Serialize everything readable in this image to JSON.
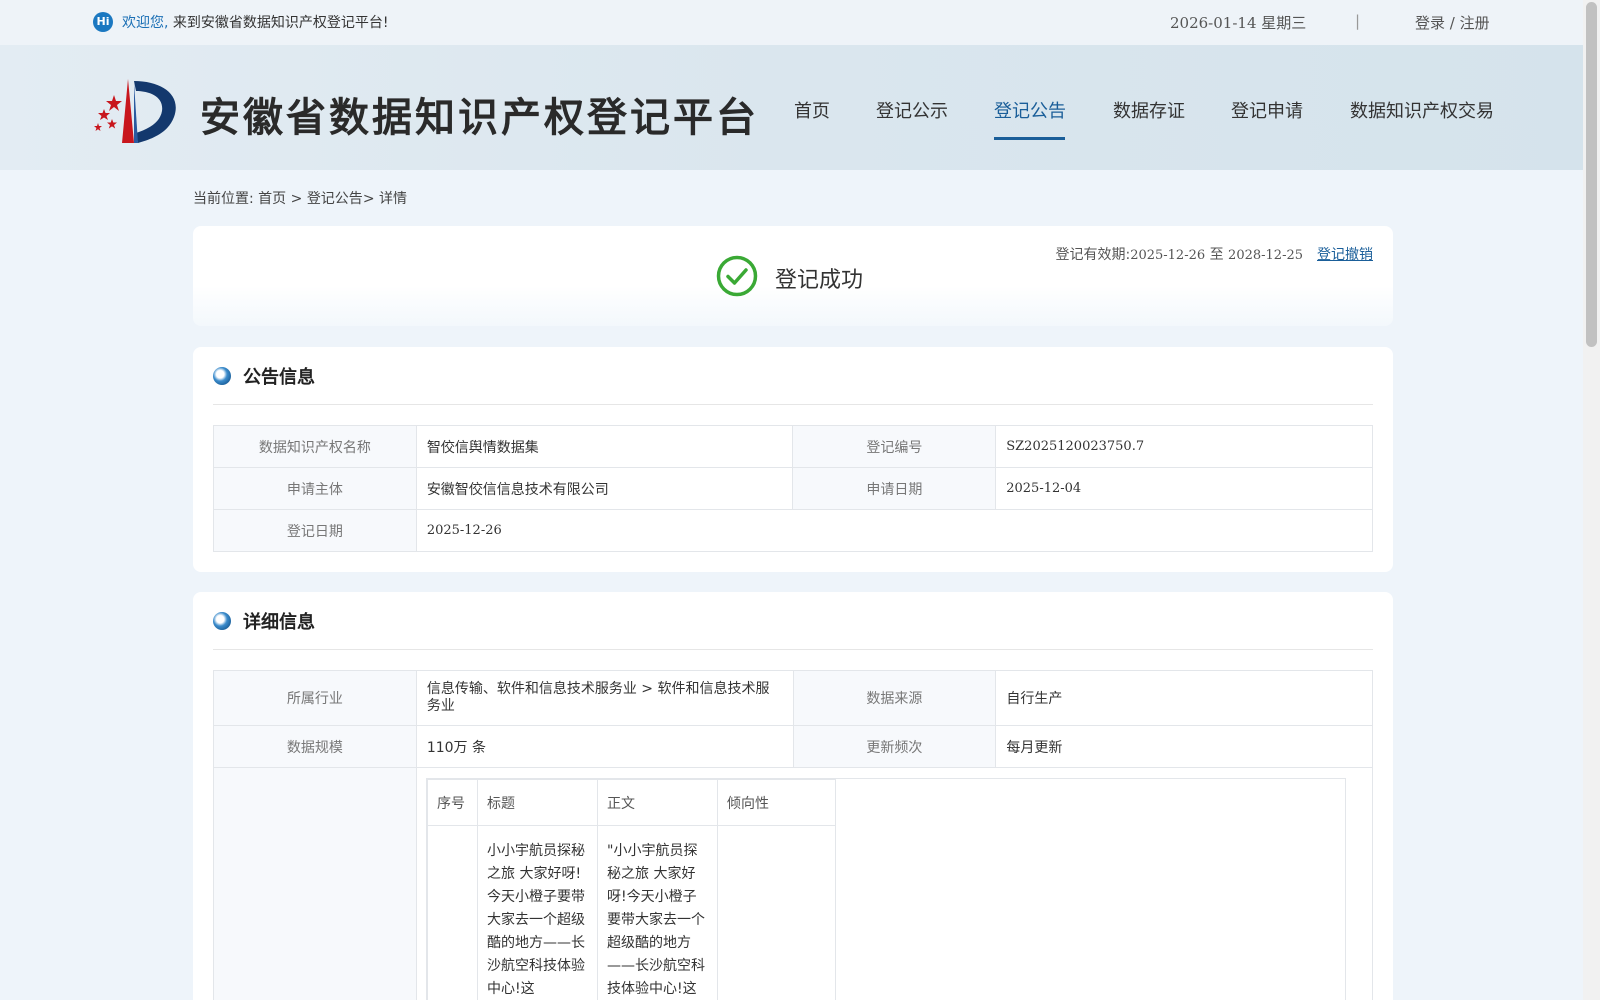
{
  "topbar": {
    "hi_badge": "Hi",
    "welcome_highlight": "欢迎您,",
    "welcome_text": "来到安徽省数据知识产权登记平台!",
    "date": "2026-01-14 星期三",
    "separator": "|",
    "login_register": "登录 / 注册"
  },
  "header": {
    "site_title": "安徽省数据知识产权登记平台",
    "nav": [
      {
        "label": "首页"
      },
      {
        "label": "登记公示"
      },
      {
        "label": "登记公告"
      },
      {
        "label": "数据存证"
      },
      {
        "label": "登记申请"
      },
      {
        "label": "数据知识产权交易"
      }
    ],
    "active_nav": "登记公告"
  },
  "breadcrumb": {
    "prefix": "当前位置:",
    "home": "首页",
    "sep1": ">",
    "section": "登记公告",
    "sep2": ">",
    "current": "详情"
  },
  "status": {
    "text": "登记成功",
    "validity_label": "登记有效期:",
    "validity_start": "2025-12-26",
    "validity_to": "至",
    "validity_end": "2028-12-25",
    "revoke_label": "登记撤销"
  },
  "notice_section": {
    "title": "公告信息",
    "rows": [
      {
        "l1": "数据知识产权名称",
        "v1": "智佼信舆情数据集",
        "l2": "登记编号",
        "v2": "SZ2025120023750.7"
      },
      {
        "l1": "申请主体",
        "v1": "安徽智佼信信息技术有限公司",
        "l2": "申请日期",
        "v2": "2025-12-04"
      },
      {
        "l1": "登记日期",
        "v1": "2025-12-26"
      }
    ]
  },
  "detail_section": {
    "title": "详细信息",
    "industry_label": "所属行业",
    "industry_value": "信息传输、软件和信息技术服务业 > 软件和信息技术服务业",
    "source_label": "数据来源",
    "source_value": "自行生产",
    "scale_label": "数据规模",
    "scale_value": "110万 条",
    "freq_label": "更新频次",
    "freq_value": "每月更新",
    "sample_table": {
      "headers": [
        "序号",
        "标题",
        "正文",
        "倾向性"
      ],
      "row": {
        "index": "",
        "title": "小小宇航员探秘之旅 大家好呀!今天小橙子要带大家去一个超级酷的地方——长沙航空科技体验中心!这",
        "body": "\"小小宇航员探秘之旅 大家好呀!今天小橙子要带大家去一个超级酷的地方——长沙航空科技体验中心!这",
        "sentiment": ""
      }
    }
  },
  "colors": {
    "accent": "#1a5e99",
    "success": "#3aa935",
    "page_bg": "#eef4fa"
  }
}
